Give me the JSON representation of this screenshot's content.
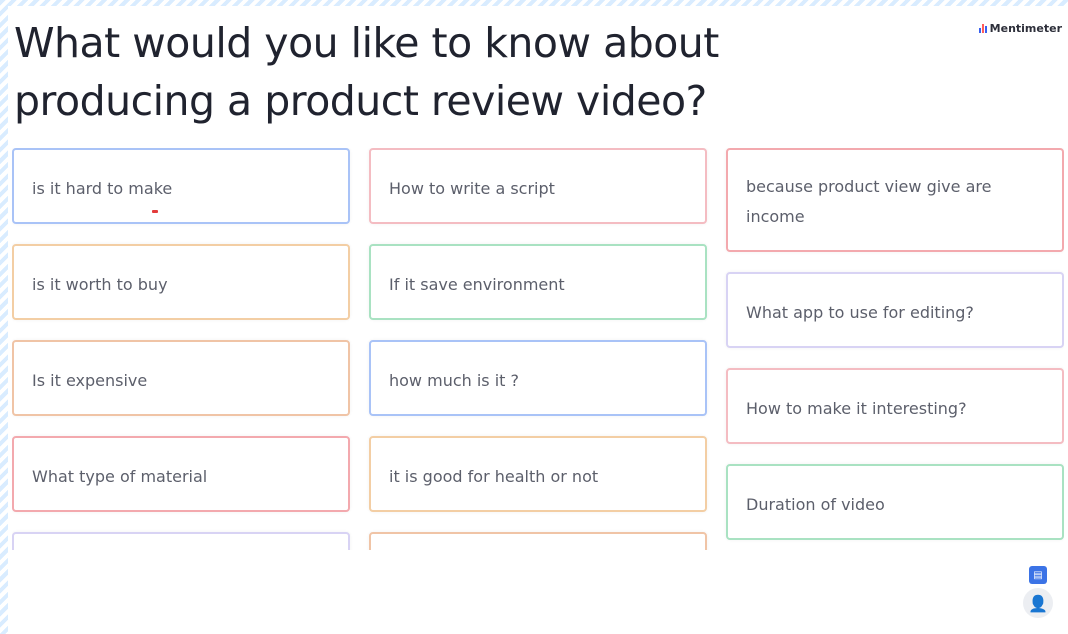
{
  "slide": {
    "title": "What would you like to know about producing a product review video?",
    "brand": "Mentimeter"
  },
  "colors": {
    "blue": "#a9c3f7",
    "pink": "#f4bcc2",
    "orange": "#f3cea4",
    "green": "#a9e2c2",
    "peach": "#f0c4a6",
    "lavender": "#d8d3f4",
    "red": "#f3a9ae",
    "brand_blue": "#3860f0"
  },
  "responses": {
    "col1": [
      {
        "text": "is it hard to make",
        "color": "blue"
      },
      {
        "text": "is it worth to buy",
        "color": "orange"
      },
      {
        "text": "Is it expensive",
        "color": "peach"
      },
      {
        "text": "What type of material",
        "color": "red"
      },
      {
        "text": "",
        "color": "lavender"
      }
    ],
    "col2": [
      {
        "text": "How to write a script",
        "color": "pink"
      },
      {
        "text": "If it save environment",
        "color": "green"
      },
      {
        "text": "how much is it ?",
        "color": "blue"
      },
      {
        "text": "it is good for health or not",
        "color": "orange"
      },
      {
        "text": "",
        "color": "peach"
      }
    ],
    "col3": [
      {
        "text": "because product view give are income",
        "color": "red"
      },
      {
        "text": "What app to use for editing?",
        "color": "lavender"
      },
      {
        "text": "How to make it interesting?",
        "color": "pink"
      },
      {
        "text": "Duration of video",
        "color": "green"
      }
    ]
  },
  "icons": {
    "fab_top": "comment-icon",
    "fab_user": "user-icon"
  }
}
